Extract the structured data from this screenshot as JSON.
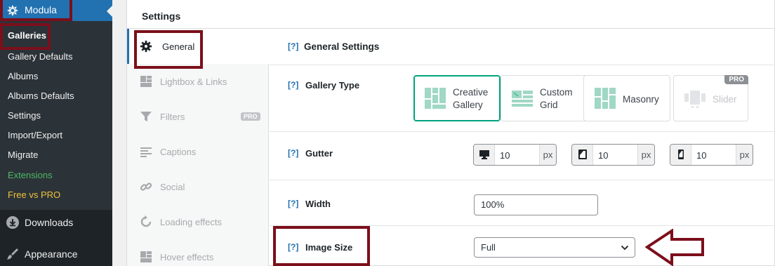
{
  "admin_menu": {
    "plugin_label": "Modula",
    "submenu": [
      {
        "label": "Galleries",
        "style": "current"
      },
      {
        "label": "Gallery Defaults",
        "style": "normal"
      },
      {
        "label": "Albums",
        "style": "normal"
      },
      {
        "label": "Albums Defaults",
        "style": "normal"
      },
      {
        "label": "Settings",
        "style": "normal"
      },
      {
        "label": "Import/Export",
        "style": "normal"
      },
      {
        "label": "Migrate",
        "style": "normal"
      },
      {
        "label": "Extensions",
        "style": "green"
      },
      {
        "label": "Free vs PRO",
        "style": "yellow"
      }
    ],
    "downloads_label": "Downloads",
    "appearance_label": "Appearance"
  },
  "settings": {
    "title": "Settings",
    "tabs": [
      {
        "label": "General",
        "icon": "gear-icon",
        "active": true
      },
      {
        "label": "Lightbox & Links",
        "icon": "lightbox-icon"
      },
      {
        "label": "Filters",
        "icon": "filter-icon",
        "badge": "PRO"
      },
      {
        "label": "Captions",
        "icon": "captions-icon"
      },
      {
        "label": "Social",
        "icon": "link-icon"
      },
      {
        "label": "Loading effects",
        "icon": "refresh-icon"
      },
      {
        "label": "Hover effects",
        "icon": "grid-icon"
      }
    ]
  },
  "general": {
    "help_marker": "[?]",
    "section_title": "General Settings",
    "gallery_type_label": "Gallery Type",
    "gallery_types": [
      {
        "line1": "Creative",
        "line2": "Gallery",
        "selected": true
      },
      {
        "line1": "Custom",
        "line2": "Grid"
      },
      {
        "line1": "Masonry",
        "line2": ""
      },
      {
        "line1": "Slider",
        "line2": "",
        "pro": "PRO",
        "disabled": true
      }
    ],
    "gutter_label": "Gutter",
    "gutter": [
      {
        "device": "desktop-icon",
        "value": "10",
        "unit": "px"
      },
      {
        "device": "tablet-icon",
        "value": "10",
        "unit": "px"
      },
      {
        "device": "mobile-icon",
        "value": "10",
        "unit": "px"
      }
    ],
    "width_label": "Width",
    "width_value": "100%",
    "image_size_label": "Image Size",
    "image_size_value": "Full"
  },
  "colors": {
    "accent": "#2271b1",
    "selected_border": "#00a37e",
    "highlight_box": "#7b0f1b",
    "sidebar_bg": "#1d2327"
  }
}
